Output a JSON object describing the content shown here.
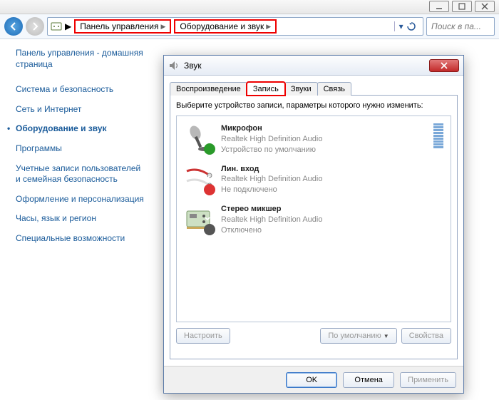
{
  "breadcrumb": {
    "control_panel": "Панель управления",
    "hardware_sound": "Оборудование и звук"
  },
  "search": {
    "placeholder": "Поиск в па..."
  },
  "sidebar": {
    "home": "Панель управления - домашняя страница",
    "items": [
      "Система и безопасность",
      "Сеть и Интернет",
      "Оборудование и звук",
      "Программы",
      "Учетные записи пользователей и семейная безопасность",
      "Оформление и персонализация",
      "Часы, язык и регион",
      "Специальные возможности"
    ],
    "active_index": 2
  },
  "sound_dialog": {
    "title": "Звук",
    "tabs": {
      "playback": "Воспроизведение",
      "recording": "Запись",
      "sounds": "Звуки",
      "comm": "Связь"
    },
    "active_tab": "recording",
    "instruction": "Выберите устройство записи, параметры которого нужно изменить:",
    "devices": [
      {
        "name": "Микрофон",
        "sub": "Realtek High Definition Audio",
        "status": "Устройство по умолчанию",
        "badge": "ok",
        "icon": "mic",
        "meter": true
      },
      {
        "name": "Лин. вход",
        "sub": "Realtek High Definition Audio",
        "status": "Не подключено",
        "badge": "no",
        "icon": "linein",
        "meter": false
      },
      {
        "name": "Стерео микшер",
        "sub": "Realtek High Definition Audio",
        "status": "Отключено",
        "badge": "down",
        "icon": "mixer",
        "meter": false
      }
    ],
    "buttons": {
      "configure": "Настроить",
      "default": "По умолчанию",
      "properties": "Свойства",
      "ok": "OK",
      "cancel": "Отмена",
      "apply": "Применить"
    }
  }
}
